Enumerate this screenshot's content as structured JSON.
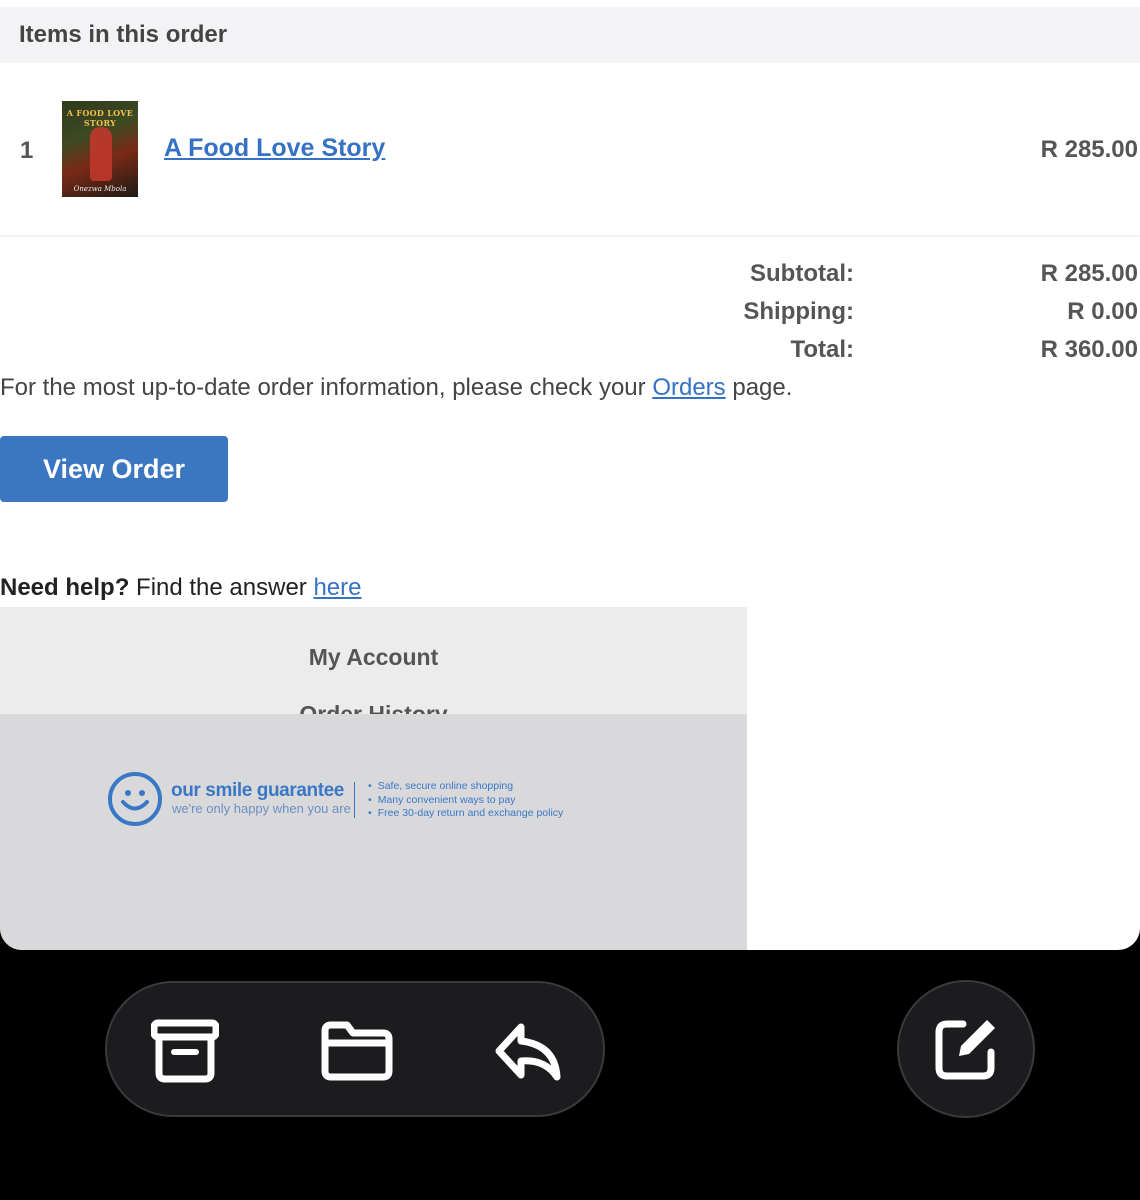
{
  "order": {
    "section_title": "Items in this order",
    "items": [
      {
        "quantity": "1",
        "title": "A Food Love Story",
        "price": "R 285.00",
        "cover_title": "A FOOD LOVE STORY",
        "cover_author": "Onezwa Mbola"
      }
    ],
    "totals": {
      "subtotal_label": "Subtotal:",
      "subtotal_value": "R 285.00",
      "shipping_label": "Shipping:",
      "shipping_value": "R 0.00",
      "total_label": "Total:",
      "total_value": "R 360.00"
    },
    "info_text_before": "For the most up-to-date order information, please check your ",
    "info_link": "Orders",
    "info_text_after": " page.",
    "view_order_button": "View Order",
    "help_strong": "Need help?",
    "help_text": " Find the answer ",
    "help_link": "here"
  },
  "footer": {
    "nav_items": [
      "My Account",
      "Order History"
    ],
    "guarantee": {
      "title": "our smile guarantee",
      "subtitle": "we're only happy when you are",
      "points": [
        "Safe, secure online shopping",
        "Many convenient ways to pay",
        "Free 30-day return and exchange policy"
      ],
      "accent_color": "#3a78c6"
    }
  },
  "toolbar": {
    "icons": [
      "archive-icon",
      "folder-icon",
      "reply-icon",
      "compose-icon"
    ]
  },
  "colors": {
    "link": "#3672c4",
    "button": "#3b76c0",
    "header_bg": "#f3f3f5",
    "toolbar_bg": "#1c1c1e"
  }
}
